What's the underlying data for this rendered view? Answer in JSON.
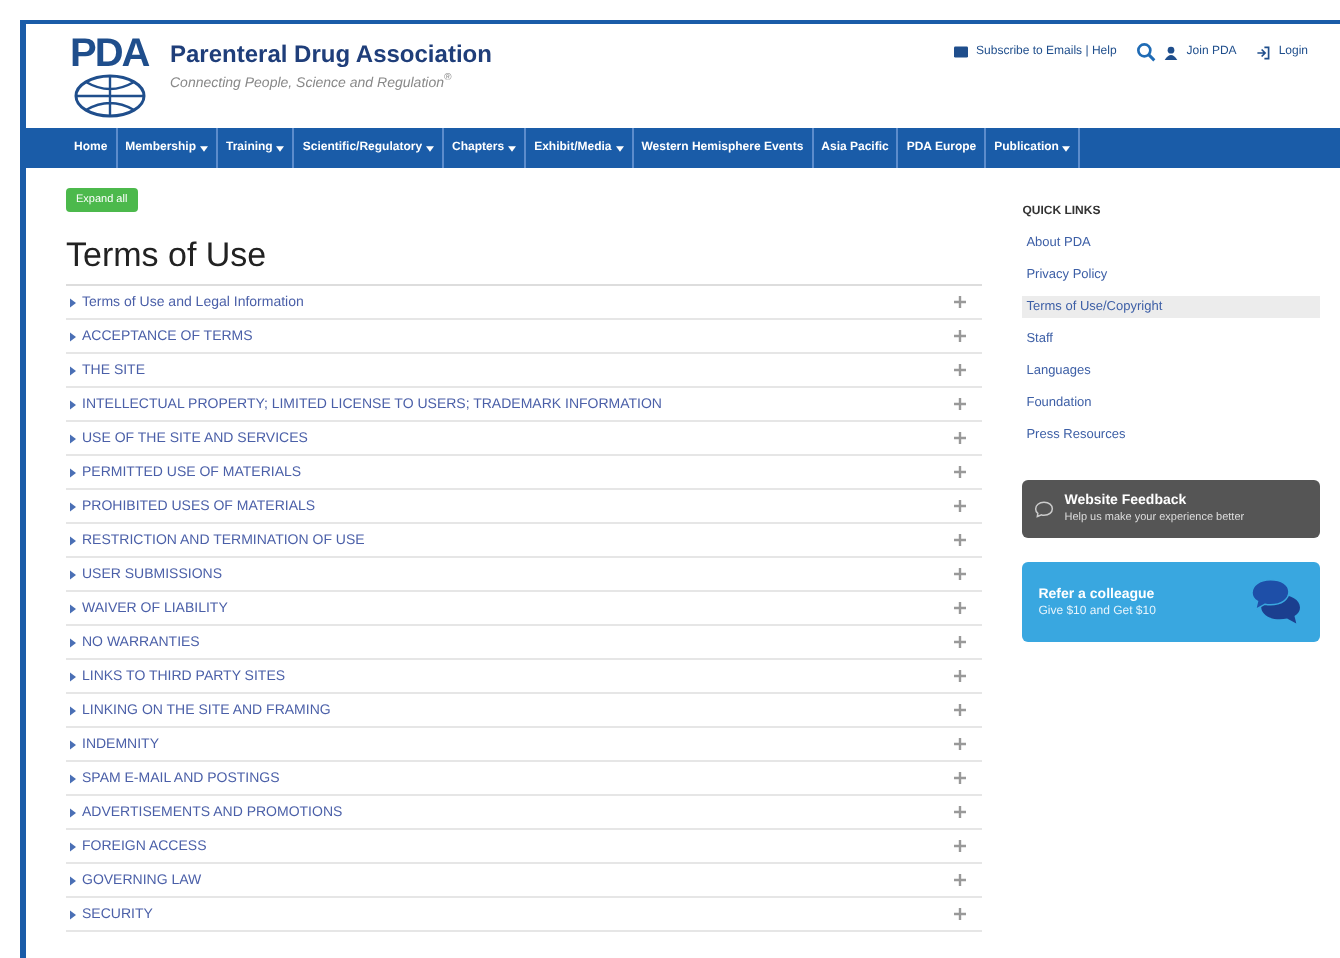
{
  "header": {
    "logo_text": "PDA",
    "org_name": "Parenteral Drug Association",
    "tagline": "Connecting People, Science and Regulation$^{®}$",
    "top_links": [
      {
        "kind": "subscribe",
        "label": "Subscribe to Emails | Help"
      },
      {
        "kind": "search"
      },
      {
        "kind": "join",
        "label": "Join PDA"
      },
      {
        "kind": "login",
        "label": "Login"
      }
    ]
  },
  "nav": [
    {
      "label": "Home",
      "dropdown": false
    },
    {
      "label": "Membership",
      "dropdown": true
    },
    {
      "label": "Training",
      "dropdown": true
    },
    {
      "label": "Scientific/Regulatory",
      "dropdown": true
    },
    {
      "label": "Chapters",
      "dropdown": true
    },
    {
      "label": "Exhibit/Media",
      "dropdown": true
    },
    {
      "label": "Western Hemisphere Events",
      "dropdown": false
    },
    {
      "label": "Asia Pacific",
      "dropdown": false
    },
    {
      "label": "PDA Europe",
      "dropdown": false
    },
    {
      "label": "Publication",
      "dropdown": true
    }
  ],
  "expand_button": "Expand all",
  "title": "Terms of Use",
  "sections": [
    {
      "label": "Terms of Use and Legal Information",
      "expanded": false
    },
    {
      "label": "ACCEPTANCE OF TERMS",
      "expanded": false
    },
    {
      "label": "THE SITE",
      "expanded": false
    },
    {
      "label": "INTELLECTUAL PROPERTY; LIMITED LICENSE TO USERS; TRADEMARK INFORMATION",
      "expanded": false
    },
    {
      "label": "USE OF THE SITE AND SERVICES",
      "expanded": false
    },
    {
      "label": "PERMITTED USE OF MATERIALS",
      "expanded": false
    },
    {
      "label": "PROHIBITED USES OF MATERIALS",
      "expanded": false
    },
    {
      "label": "RESTRICTION AND TERMINATION OF USE",
      "expanded": false
    },
    {
      "label": "USER SUBMISSIONS",
      "expanded": false
    },
    {
      "label": "WAIVER OF LIABILITY",
      "expanded": false
    },
    {
      "label": "NO WARRANTIES",
      "expanded": false
    },
    {
      "label": "LINKS TO THIRD PARTY SITES",
      "expanded": false
    },
    {
      "label": "LINKING ON THE SITE AND FRAMING",
      "expanded": false
    },
    {
      "label": "INDEMNITY",
      "expanded": false
    },
    {
      "label": "SPAM E-MAIL AND POSTINGS",
      "expanded": false
    },
    {
      "label": "ADVERTISEMENTS AND PROMOTIONS",
      "expanded": false
    },
    {
      "label": "FOREIGN ACCESS",
      "expanded": false
    },
    {
      "label": "GOVERNING LAW",
      "expanded": false
    },
    {
      "label": "SECURITY",
      "expanded": false
    }
  ],
  "quick_links": {
    "title": "QUICK LINKS",
    "items": [
      {
        "label": "About PDA",
        "selected": false
      },
      {
        "label": "Privacy Policy",
        "selected": false
      },
      {
        "label": "Terms of Use/Copyright",
        "selected": true
      },
      {
        "label": "Staff",
        "selected": false
      },
      {
        "label": "Languages",
        "selected": false
      },
      {
        "label": "Foundation",
        "selected": false
      },
      {
        "label": "Press Resources",
        "selected": false
      }
    ]
  },
  "feedback": {
    "title": "Website Feedback",
    "subtitle": "Help us make your experience better"
  },
  "refer": {
    "title": "Refer a colleague",
    "subtitle": "Give $10 and Get $10"
  }
}
